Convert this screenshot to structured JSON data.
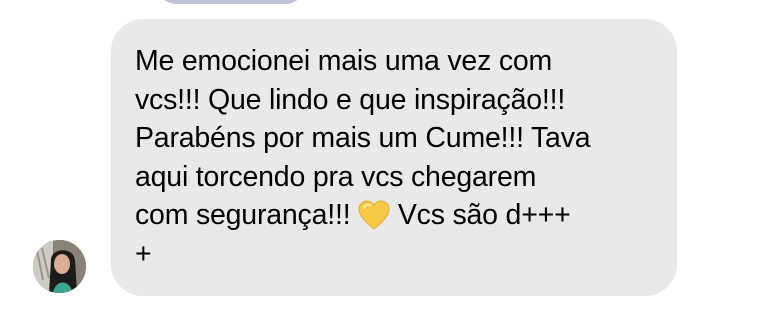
{
  "message": {
    "line_1": "Me emocionei mais uma vez com",
    "line_2": "vcs!!! Que lindo e que inspiração!!!",
    "line_3": "Parabéns por mais um Cume!!! Tava",
    "line_4": "aqui torcendo pra vcs chegarem",
    "line_5a": "com segurança!!! ",
    "emoji": "yellow-heart-icon",
    "line_5b": " Vcs são d+++",
    "line_6": "+"
  },
  "colors": {
    "bubble": "#e9e9eb",
    "text": "#000000",
    "heart": "#f7c947",
    "previous_bubble": "#bcc3d6"
  }
}
